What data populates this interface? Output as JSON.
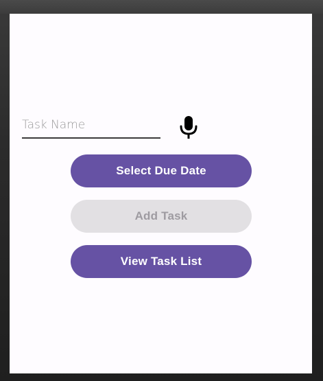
{
  "task_input": {
    "placeholder": "Task Name",
    "value": ""
  },
  "mic_button": {
    "icon": "microphone-icon"
  },
  "buttons": {
    "select_due_date": "Select Due Date",
    "add_task": "Add Task",
    "view_task_list": "View Task List"
  },
  "colors": {
    "primary": "#6652a4",
    "disabled_bg": "#e2e0e3",
    "disabled_text": "#9e9ba1",
    "screen_bg": "#fefcff"
  }
}
